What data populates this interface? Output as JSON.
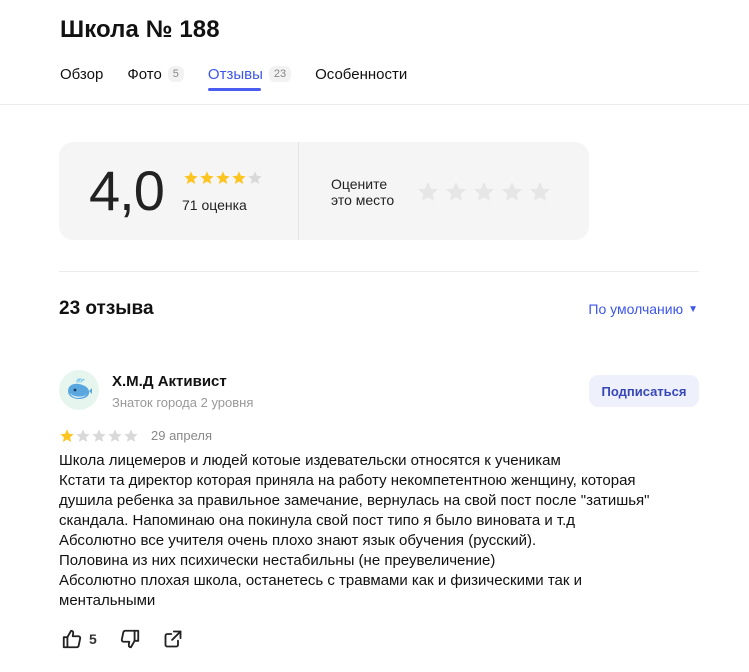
{
  "page": {
    "title": "Школа № 188"
  },
  "tabs": [
    {
      "label": "Обзор",
      "count": ""
    },
    {
      "label": "Фото",
      "count": "5"
    },
    {
      "label": "Отзывы",
      "count": "23",
      "active": true
    },
    {
      "label": "Особенности",
      "count": ""
    }
  ],
  "rating": {
    "value": "4,0",
    "stars_filled": 4,
    "stars_total": 5,
    "count_label": "71 оценка",
    "rate_prompt": "Оцените\nэто место",
    "rate_stars": 5
  },
  "reviews": {
    "count_label": "23 отзыва",
    "sort_label": "По умолчанию"
  },
  "review": {
    "author": "Х.М.Д Активист",
    "level": "Знаток города 2 уровня",
    "subscribe_label": "Подписаться",
    "stars_filled": 1,
    "date": "29 апреля",
    "text_lines": [
      "Школа лицемеров и людей котоые издевательски относятся к ученикам",
      "Кстати та директор которая приняла на работу некомпетентною женщину, которая",
      "душила ребенка за правильное замечание, вернулась на свой пост после \"затишья\"",
      "скандала. Напоминаю она покинула свой пост типо я было виновата и т.д",
      "Абсолютно все учителя очень плохо знают язык обучения (русский).",
      "Половина из них психически нестабильны (не преувеличение)",
      "Абсолютно плохая школа, останетесь с травмами как и физическими так и",
      "ментальными"
    ],
    "likes": "5"
  },
  "colors": {
    "accent": "#3d56e8",
    "star_filled": "#fcc521",
    "star_empty": "#d9d9d9",
    "star_rate_empty": "#e6e6e6"
  },
  "icons": {
    "avatar": "whale-icon",
    "like": "thumb-up-icon",
    "dislike": "thumb-down-icon",
    "share": "share-icon",
    "sort": "caret-down-icon"
  }
}
